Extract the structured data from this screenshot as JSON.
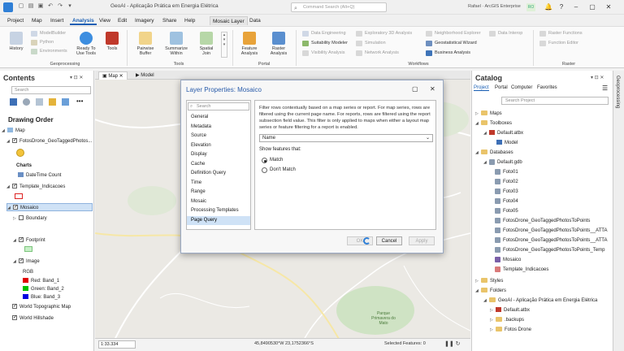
{
  "titlebar": {
    "title": "GeoAI - Aplicação Prática em Energia Elétrica",
    "command_search_placeholder": "Command Search (Alt+Q)",
    "user": "Rafael · ArcGIS Enterprise",
    "user_initials": "RO",
    "window_controls": [
      "minimize-icon",
      "maximize-icon",
      "close-icon"
    ]
  },
  "menu_tabs": [
    "Project",
    "Map",
    "Insert",
    "Analysis",
    "View",
    "Edit",
    "Imagery",
    "Share",
    "Help",
    "Mosaic Layer",
    "Data"
  ],
  "active_tab": "Analysis",
  "ribbon": {
    "geoprocessing": {
      "label": "Geoprocessing",
      "history": "History",
      "model_builder": "ModelBuilder",
      "python": "Python",
      "environments": "Environments",
      "ready_to_use": "Ready To Use Tools",
      "tools": "Tools"
    },
    "tools_group": {
      "label": "Tools",
      "pairwise_buffer": "Pairwise Buffer",
      "summarize_within": "Summarize Within",
      "spatial_join": "Spatial Join"
    },
    "portal": {
      "label": "Portal",
      "feature_analysis": "Feature Analysis",
      "raster_analysis": "Raster Analysis"
    },
    "workflows": {
      "label": "Workflows",
      "data_engineering": "Data Engineering",
      "suitability_modeler": "Suitability Modeler",
      "visibility_analysis": "Visibility Analysis",
      "exploratory_3d": "Exploratory 3D Analysis",
      "simulation": "Simulation",
      "network_analysis": "Network Analysis",
      "neighborhood_explorer": "Neighborhood Explorer",
      "geostatistical_wizard": "Geostatistical Wizard",
      "business_analysis": "Business Analysis",
      "data_interop": "Data Interop"
    },
    "raster": {
      "label": "Raster",
      "raster_functions": "Raster Functions",
      "function_editor": "Function Editor"
    }
  },
  "contents": {
    "title": "Contents",
    "search_placeholder": "Search",
    "drawing_order": "Drawing Order",
    "items": {
      "map": "Map",
      "fotos": "FotosDrone_GeoTaggedPhotos...",
      "charts": "Charts",
      "datetime": "DateTime Count",
      "template": "Template_Indicacoes",
      "mosaico": "Mosaico",
      "boundary": "Boundary",
      "footprint": "Footprint",
      "image": "Image",
      "rgb": "RGB",
      "red": "Red:   Band_1",
      "green": "Green: Band_2",
      "blue": "Blue:  Band_3",
      "topo": "World Topographic Map",
      "hillshade": "World Hillshade"
    },
    "colors": {
      "red": "#e00000",
      "green": "#00c000",
      "blue": "#0000e0"
    }
  },
  "map_tabs": [
    "Map",
    "Model"
  ],
  "map_labels": {
    "park": "Parque Primavera do Mato"
  },
  "statusbar": {
    "scale": "1:33.334",
    "coords": "45,8490530°W 23,1752366°S",
    "selected": "Selected Features: 0"
  },
  "dialog": {
    "title": "Layer Properties: Mosaico",
    "search_placeholder": "Search",
    "nav": [
      "General",
      "Metadata",
      "Source",
      "Elevation",
      "Display",
      "Cache",
      "Definition Query",
      "Time",
      "Range",
      "Mosaic",
      "Processing Templates",
      "Page Query"
    ],
    "selected_nav": "Page Query",
    "description": "Filter rows contextually based on a map series or report.  For map series, rows are filtered using the current page name. For reports, rows are filtered using the report subsection field value. This filter is only applied to maps when either a layout map series or feature filtering for a report is enabled.",
    "field_value": "Name",
    "show_label": "Show features that:",
    "match": "Match",
    "dont_match": "Don't Match",
    "ok": "OK",
    "cancel": "Cancel",
    "apply": "Apply"
  },
  "catalog": {
    "title": "Catalog",
    "tabs": [
      "Project",
      "Portal",
      "Computer",
      "Favorites"
    ],
    "search_placeholder": "Search Project",
    "items": {
      "maps": "Maps",
      "toolboxes": "Toolboxes",
      "default_atbx": "Default.atbx",
      "model": "Model",
      "databases": "Databases",
      "default_gdb": "Default.gdb",
      "foto01": "Foto01",
      "foto02": "Foto02",
      "foto03": "Foto03",
      "foto04": "Foto04",
      "foto05": "Foto05",
      "fd1": "FotosDrone_GeoTaggedPhotosToPoints",
      "fd2": "FotosDrone_GeoTaggedPhotosToPoints__ATTA",
      "fd3": "FotosDrone_GeoTaggedPhotosToPoints__ATTA",
      "fd4": "FotosDrone_GeoTaggedPhotosToPoints_Temp",
      "mosaico": "Mosaico",
      "template": "Template_Indicacoes",
      "styles": "Styles",
      "folders": "Folders",
      "geoai_folder": "GeoAI - Aplicação Prática em Energia Elétrica",
      "default_atbx2": "Default.atbx",
      "backups": ".backups",
      "fotos_drone": "Fotos Drone"
    }
  },
  "right_strip": "Geoprocessing"
}
